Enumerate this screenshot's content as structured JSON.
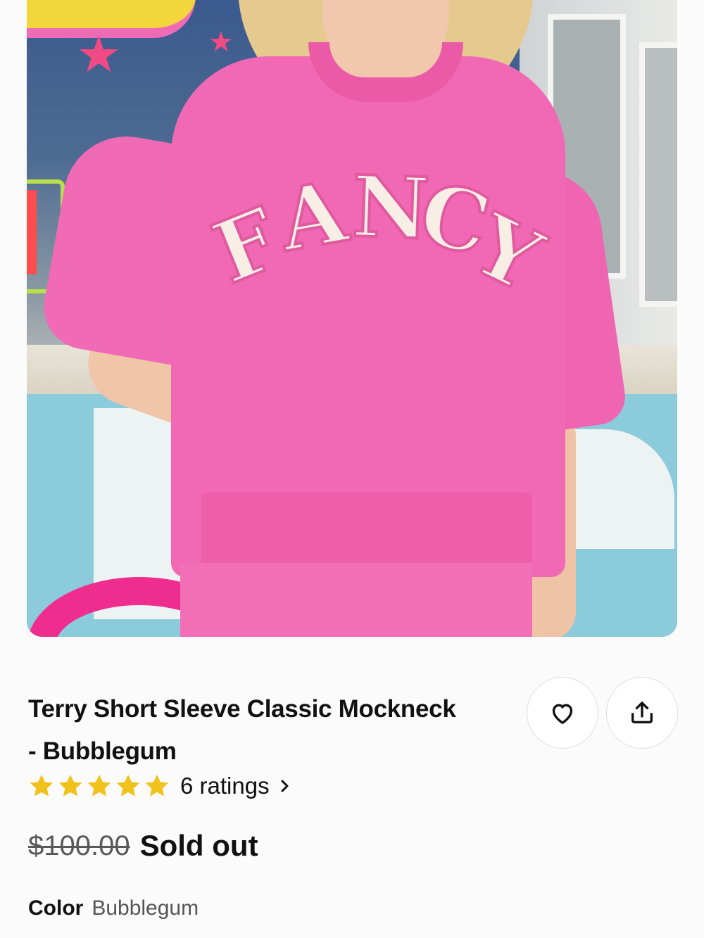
{
  "product": {
    "title_line1": "Terry Short Sleeve Classic Mockneck",
    "title_line2": "- Bubblegum",
    "image_graphic_text": "FANCY",
    "rating": {
      "stars": 5,
      "max_stars": 5,
      "text": "6 ratings"
    },
    "price": {
      "original": "$100.00",
      "status": "Sold out"
    },
    "color": {
      "label": "Color",
      "value": "Bubblegum"
    }
  },
  "actions": {
    "favorite_icon": "heart-icon",
    "share_icon": "share-upload-icon"
  },
  "colors": {
    "star": "#F1C21B",
    "shirt": "#F168B4",
    "text": "#111111",
    "muted": "#555555"
  }
}
